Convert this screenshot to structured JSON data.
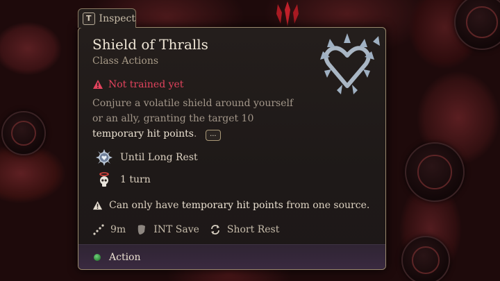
{
  "inspect": {
    "key": "T",
    "label": "Inspect"
  },
  "spell": {
    "title": "Shield of Thralls",
    "category": "Class Actions",
    "warning": "Not trained yet",
    "description_lines": [
      "Conjure a volatile shield around yourself",
      "or an ally, granting the target 10"
    ],
    "description_highlight": "temporary hit points",
    "description_tail": ".",
    "more_label": "...",
    "duration_label": "Until Long Rest",
    "turns_label": "1 turn",
    "note_prefix": "Can only have ",
    "note_highlight": "temporary hit points",
    "note_suffix": " from one source.",
    "range": "9m",
    "save": "INT Save",
    "recharge": "Short Rest",
    "cost": "Action"
  },
  "colors": {
    "warning": "#e2435d",
    "action_dot": "#3fa34d",
    "footer": "#352839",
    "border": "#9b8a6e"
  },
  "icons": {
    "spell": "spiked-heart-icon",
    "warning": "warning-triangle-icon",
    "duration": "spiked-emblem-icon",
    "turns": "skull-halo-icon",
    "range": "dotted-line-icon",
    "save": "shield-small-icon",
    "recharge": "refresh-arrows-icon",
    "cost": "green-dot-icon"
  }
}
